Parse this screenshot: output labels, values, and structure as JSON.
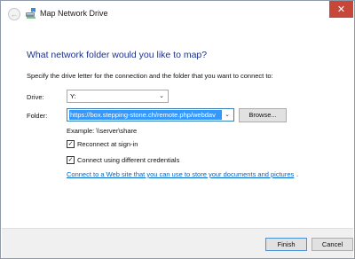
{
  "window": {
    "title": "Map Network Drive",
    "close_glyph": "✕",
    "back_glyph": "←"
  },
  "main": {
    "heading": "What network folder would you like to map?",
    "instruction": "Specify the drive letter for the connection and the folder that you want to connect to:",
    "drive_label": "Drive:",
    "drive_value": "Y:",
    "folder_label": "Folder:",
    "folder_value": "https://box.stepping-stone.ch/remote.php/webdav",
    "browse_label": "Browse...",
    "example_text": "Example: \\\\server\\share",
    "reconnect_label": "Reconnect at sign-in",
    "reconnect_checked": true,
    "different_credentials_label": "Connect using different credentials",
    "different_credentials_checked": true,
    "web_link_text": "Connect to a Web site that you can use to store your documents and pictures",
    "web_link_suffix": "."
  },
  "footer": {
    "finish_label": "Finish",
    "cancel_label": "Cancel"
  },
  "icons": {
    "back": "back-arrow-icon",
    "app": "network-drive-icon",
    "close": "close-icon",
    "chevron": "chevron-down-icon",
    "check": "checkmark-icon"
  },
  "colors": {
    "heading": "#1e3287",
    "link": "#0066cc",
    "close_button": "#c7463a",
    "selection": "#3399ff"
  }
}
